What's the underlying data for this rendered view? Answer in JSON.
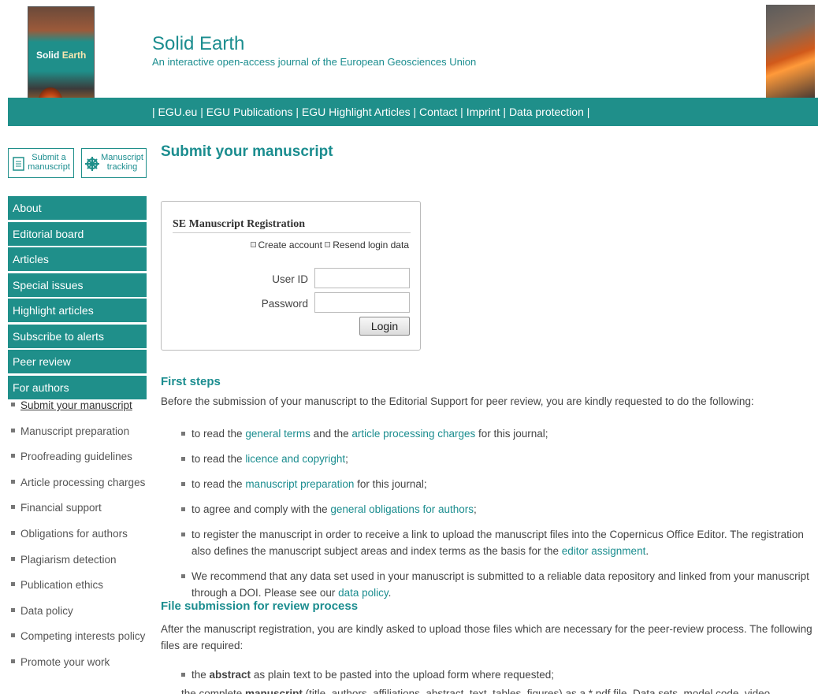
{
  "header": {
    "cover": {
      "title_1": "Solid",
      "title_2": "Earth"
    },
    "journal_title": "Solid Earth",
    "journal_subtitle": "An interactive open-access journal of the European Geosciences Union",
    "nav": {
      "prefix": "| ",
      "items": [
        "EGU.eu",
        "EGU Publications",
        "EGU Highlight Articles",
        "Contact",
        "Imprint",
        "Data protection"
      ],
      "separator": " | ",
      "suffix": " |"
    }
  },
  "sidebar": {
    "quick_buttons": [
      {
        "label_line1": "Submit a",
        "label_line2": "manuscript",
        "icon": "document-icon"
      },
      {
        "label_line1": "Manuscript",
        "label_line2": "tracking",
        "icon": "helm-icon"
      }
    ],
    "menu": [
      "About",
      "Editorial board",
      "Articles",
      "Special issues",
      "Highlight articles",
      "Subscribe to alerts",
      "Peer review",
      "For authors"
    ],
    "submenu": [
      "Submit your manuscript",
      "Manuscript preparation",
      "Proofreading guidelines",
      "Article processing charges",
      "Financial support",
      "Obligations for authors",
      "Plagiarism detection",
      "Publication ethics",
      "Data policy",
      "Competing interests policy",
      "Promote your work"
    ],
    "active_submenu_index": 0
  },
  "main": {
    "page_title": "Submit your manuscript",
    "login": {
      "heading": "SE Manuscript Registration",
      "create_account": "Create account",
      "resend_login": "Resend login data",
      "user_label": "User ID",
      "password_label": "Password",
      "user_value": "",
      "password_value": "",
      "login_button": "Login"
    },
    "first_steps": {
      "heading": "First steps",
      "intro": "Before the submission of your manuscript to the Editorial Support for peer review, you are kindly requested to do the following:",
      "items": [
        {
          "pre": "to read the ",
          "link1": "general terms",
          "mid": " and the ",
          "link2": "article processing charges",
          "post": " for this journal;"
        },
        {
          "pre": "to read the ",
          "link1": "licence and copyright",
          "post": ";"
        },
        {
          "pre": "to read the ",
          "link1": "manuscript preparation",
          "post": " for this journal;"
        },
        {
          "pre": "to agree and comply with the ",
          "link1": "general obligations for authors",
          "post": ";"
        },
        {
          "pre": "to register the manuscript in order to receive a link to upload the manuscript files into the Copernicus Office Editor. The registration also defines the manuscript subject areas and index terms as the basis for the ",
          "link1": "editor assignment",
          "post": "."
        },
        {
          "pre": "We recommend that any data set used in your manuscript is submitted to a reliable data repository and linked from your manuscript through a DOI. Please see our ",
          "link1": "data policy",
          "post": "."
        }
      ]
    },
    "file_submission": {
      "heading": "File submission for review process",
      "intro": "After the manuscript registration, you are kindly asked to upload those files which are necessary for the peer-review process. The following files are required:",
      "items": [
        {
          "pre": "the ",
          "bold": "abstract",
          "post": " as plain text to be pasted into the upload form where requested;"
        },
        {
          "pre": "the complete ",
          "bold": "manuscript",
          "post": " (title, authors, affiliations, abstract, text, tables, figures) as a *.pdf file. Data sets, model code, video"
        }
      ]
    }
  },
  "colors": {
    "brand_teal": "#1f8f8a",
    "link_teal": "#1b8d8f"
  }
}
